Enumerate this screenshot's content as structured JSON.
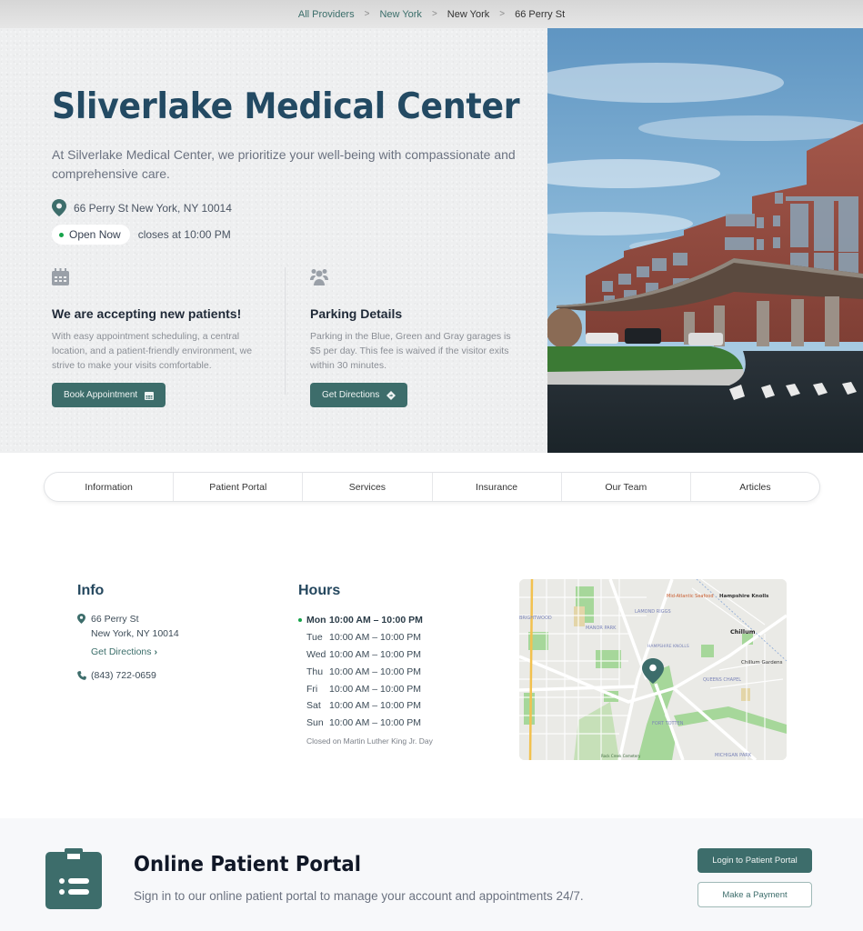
{
  "breadcrumb": {
    "items": [
      {
        "label": "All Providers",
        "link": true
      },
      {
        "label": "New York",
        "link": true
      },
      {
        "label": "New York",
        "link": false
      },
      {
        "label": "66 Perry St",
        "link": false
      }
    ],
    "separator": ">"
  },
  "hero": {
    "title": "Sliverlake Medical Center",
    "description": "At Silverlake Medical Center, we prioritize your well-being with compassionate and comprehensive care.",
    "address": "66 Perry St New York, NY 10014",
    "status_badge": "Open Now",
    "closing_text": "closes at 10:00 PM",
    "cards": [
      {
        "icon": "calendar-icon",
        "title": "We are accepting new patients!",
        "text": "With easy appointment scheduling, a central location, and a patient-friendly environment, we strive to make your visits comfortable.",
        "button": "Book Appointment",
        "button_icon": "calendar-icon"
      },
      {
        "icon": "people-icon",
        "title": "Parking Details",
        "text": "Parking in the Blue, Green and Gray garages is $5 per day. This fee is waived if the visitor exits within 30 minutes.",
        "button": "Get Directions",
        "button_icon": "directions-icon"
      }
    ],
    "image_alt": "hospital-building-photo"
  },
  "tabs": [
    "Information",
    "Patient Portal",
    "Services",
    "Insurance",
    "Our Team",
    "Articles"
  ],
  "info": {
    "heading": "Info",
    "address_line1": "66 Perry St",
    "address_line2": "New York, NY 10014",
    "directions_link": "Get Directions",
    "directions_chevron": "›",
    "phone": "(843) 722-0659"
  },
  "hours": {
    "heading": "Hours",
    "rows": [
      {
        "day": "Mon",
        "time": "10:00 AM – 10:00 PM",
        "today": true
      },
      {
        "day": "Tue",
        "time": "10:00 AM – 10:00 PM",
        "today": false
      },
      {
        "day": "Wed",
        "time": "10:00 AM – 10:00 PM",
        "today": false
      },
      {
        "day": "Thu",
        "time": "10:00 AM – 10:00 PM",
        "today": false
      },
      {
        "day": "Fri",
        "time": "10:00 AM – 10:00 PM",
        "today": false
      },
      {
        "day": "Sat",
        "time": "10:00 AM – 10:00 PM",
        "today": false
      },
      {
        "day": "Sun",
        "time": "10:00 AM – 10:00 PM",
        "today": false
      }
    ],
    "note": "Closed on Martin Luther King Jr. Day"
  },
  "map": {
    "labels": {
      "hampshire_knolls": "Hampshire Knolls",
      "chillum": "Chillum",
      "chillum_gardens": "Chillum Gardens",
      "lamond_riggs": "LAMOND RIGGS",
      "manor_park": "MANOR PARK",
      "queens_chapel": "QUEENS CHAPEL",
      "fort_totten": "FORT TOTTEN",
      "michigan_park": "MICHIGAN PARK",
      "brightwood": "BRIGHTWOOD",
      "hampshire_knolls_district": "HAMPSHIRE KNOLLS",
      "mid_atlantic_seafood": "Mid-Atlantic Seafood",
      "rock_creek_cemetery": "Rock Creek Cemetery"
    }
  },
  "portal": {
    "icon": "clipboard-list-icon",
    "title": "Online Patient Portal",
    "description": "Sign in to our online patient portal to manage your account and appointments 24/7.",
    "login_button": "Login to Patient Portal",
    "payment_button": "Make a Payment"
  },
  "colors": {
    "brand_teal": "#3d6d6b",
    "heading_navy": "#234a63",
    "open_green": "#16a34a"
  }
}
